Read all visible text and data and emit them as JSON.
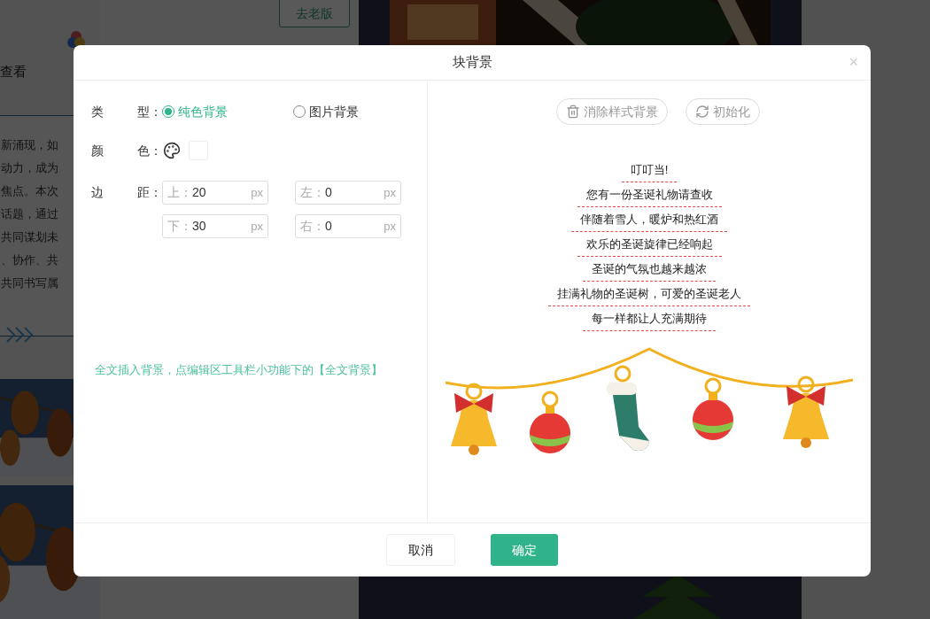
{
  "background": {
    "sidebar_link": "查看",
    "article_lines": [
      "新涌现，如",
      "动力，成为",
      "焦点。本次",
      "话题，通过",
      "共同谋划未",
      "、协作、共",
      "共同书写属"
    ],
    "old_version_button": "去老版"
  },
  "dialog": {
    "title": "块背景",
    "close": "×",
    "type_row": {
      "label": [
        "类",
        "型："
      ],
      "options": [
        {
          "label": "纯色背景",
          "selected": true
        },
        {
          "label": "图片背景",
          "selected": false
        }
      ]
    },
    "color_row": {
      "label": [
        "颜",
        "色："
      ]
    },
    "margin_row": {
      "label": [
        "边",
        "距："
      ],
      "fields": [
        {
          "prefix": "上：",
          "value": "20",
          "unit": "px"
        },
        {
          "prefix": "左：",
          "value": "0",
          "unit": "px"
        },
        {
          "prefix": "下：",
          "value": "30",
          "unit": "px"
        },
        {
          "prefix": "右：",
          "value": "0",
          "unit": "px"
        }
      ]
    },
    "hint": "全文插入背景，点编辑区工具栏小功能下的【全文背景】",
    "preview_buttons": [
      {
        "kind": "delete",
        "label": "消除样式背景"
      },
      {
        "kind": "reset",
        "label": "初始化"
      }
    ],
    "preview_lines": [
      "叮叮当!",
      "您有一份圣诞礼物请查收",
      "伴随着雪人，暖炉和热红酒",
      "欢乐的圣诞旋律已经响起",
      "圣诞的气氛也越来越浓",
      "挂满礼物的圣诞树，可爱的圣诞老人",
      "每一样都让人充满期待"
    ],
    "footer_buttons": [
      {
        "kind": "cancel",
        "label": "取消"
      },
      {
        "kind": "confirm",
        "label": "确定"
      }
    ]
  }
}
